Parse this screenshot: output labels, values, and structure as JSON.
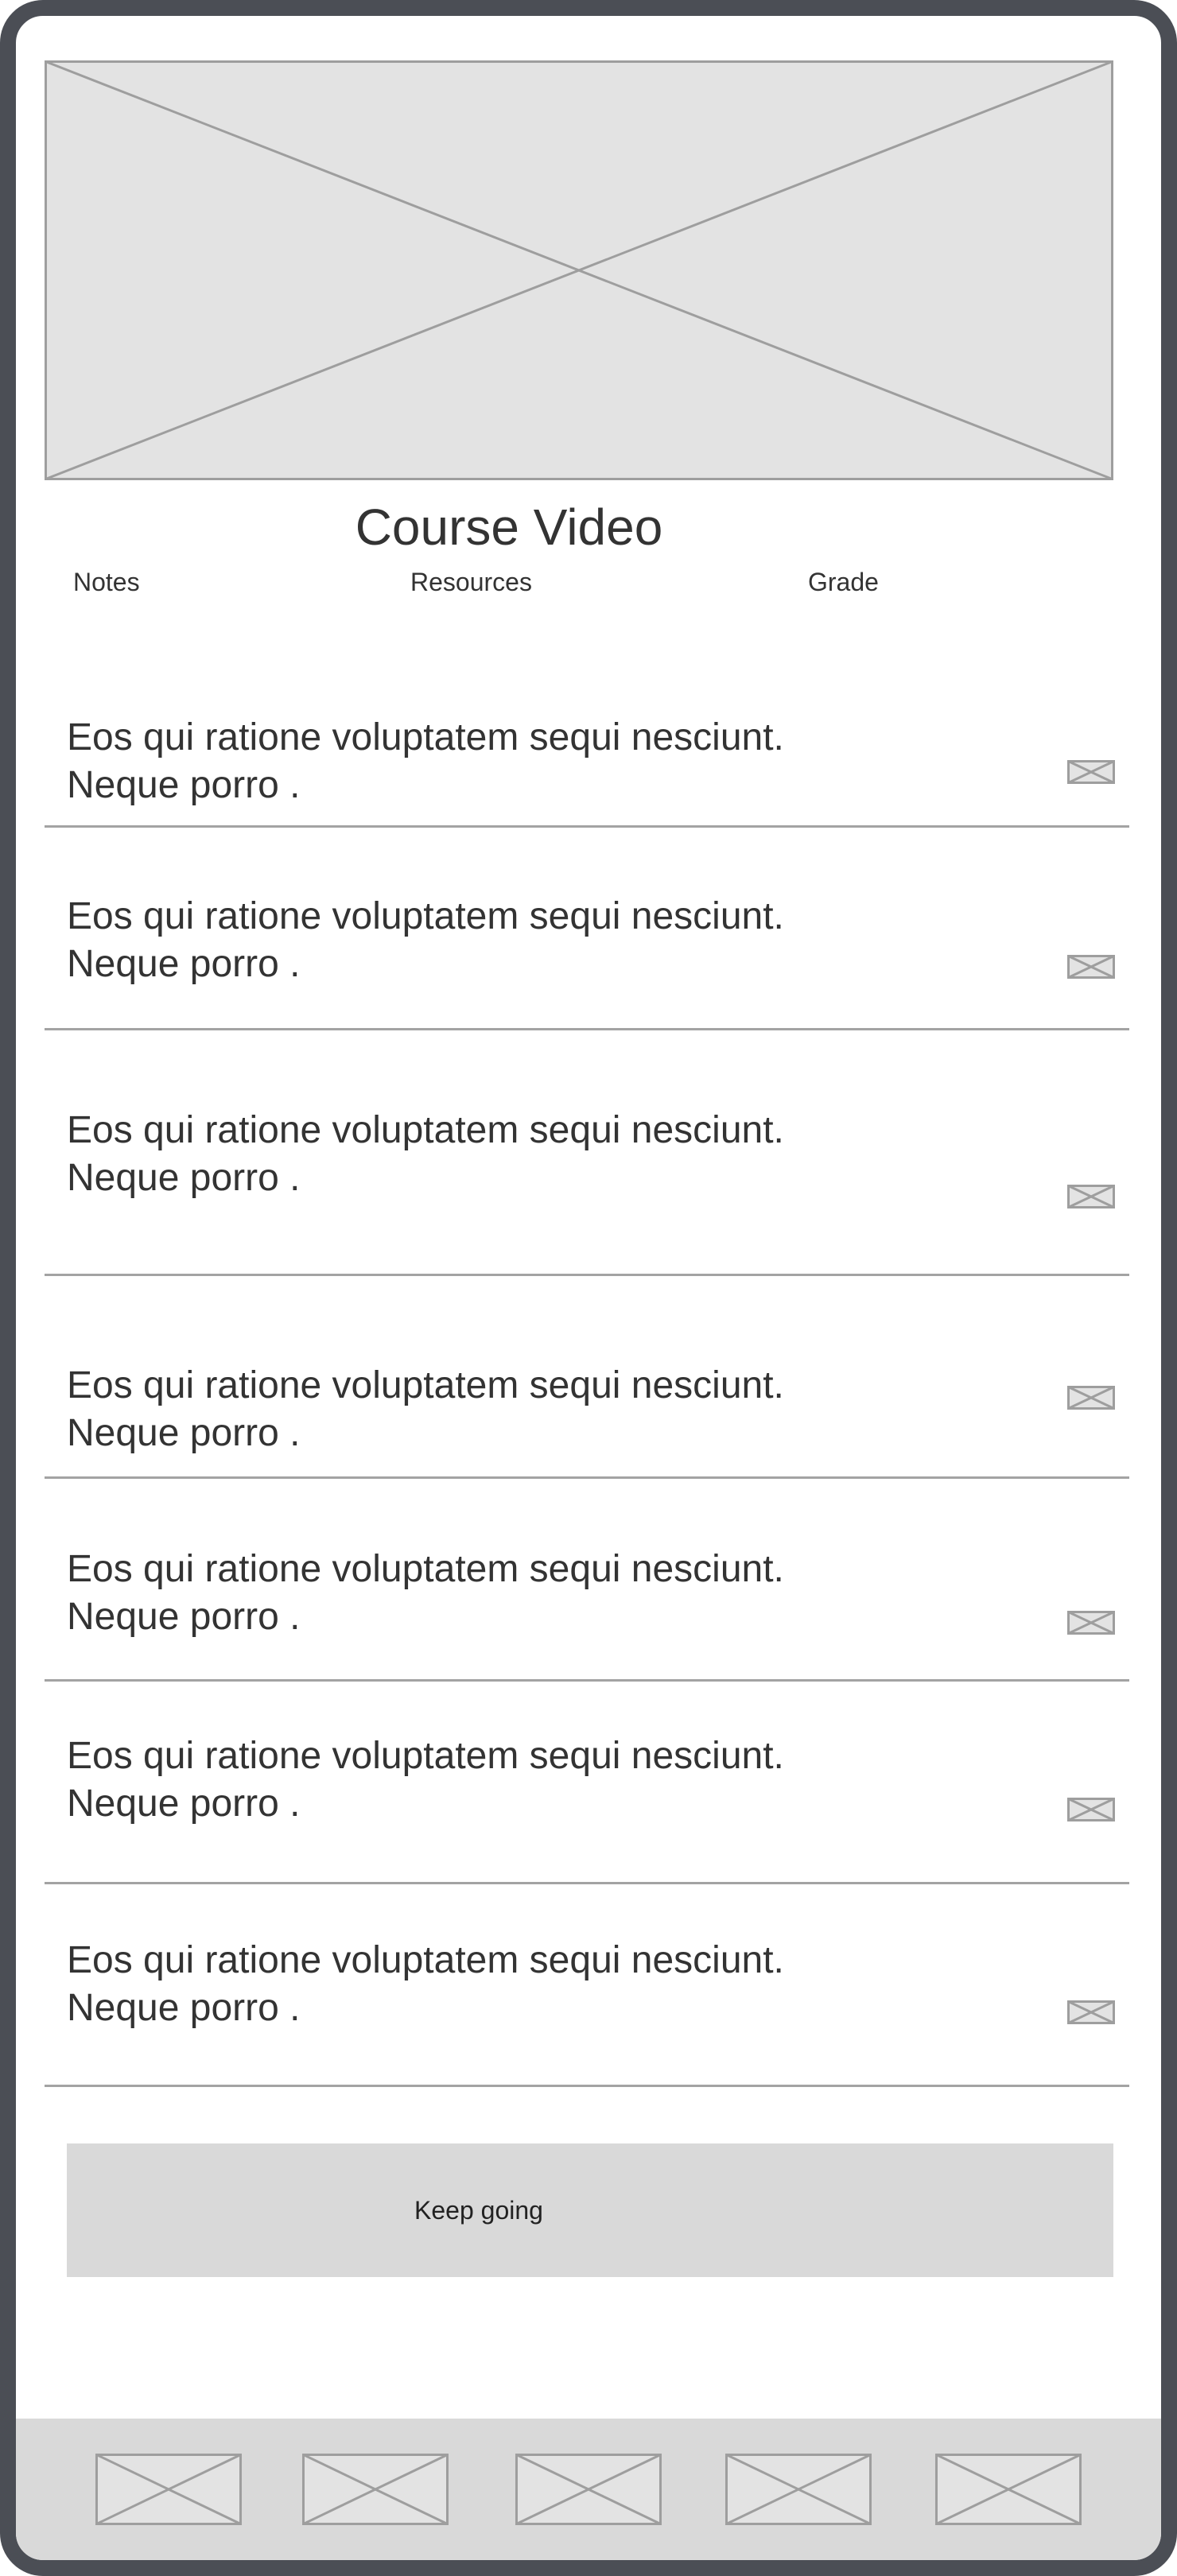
{
  "video": {
    "title": "Course Video",
    "placeholder_icon": "video-placeholder-icon"
  },
  "tabs": [
    {
      "label": "Notes"
    },
    {
      "label": "Resources"
    },
    {
      "label": "Grade"
    }
  ],
  "lessons": [
    {
      "line1": "Eos qui ratione voluptatem sequi nesciunt.",
      "line2": "Neque porro .",
      "icon": "image-placeholder-icon"
    },
    {
      "line1": "Eos qui ratione voluptatem sequi nesciunt.",
      "line2": "Neque porro .",
      "icon": "image-placeholder-icon"
    },
    {
      "line1": "Eos qui ratione voluptatem sequi nesciunt.",
      "line2": "Neque porro .",
      "icon": "image-placeholder-icon"
    },
    {
      "line1": "Eos qui ratione voluptatem sequi nesciunt.",
      "line2": "Neque porro .",
      "icon": "image-placeholder-icon"
    },
    {
      "line1": "Eos qui ratione voluptatem sequi nesciunt.",
      "line2": "Neque porro .",
      "icon": "image-placeholder-icon"
    },
    {
      "line1": "Eos qui ratione voluptatem sequi nesciunt.",
      "line2": "Neque porro .",
      "icon": "image-placeholder-icon"
    },
    {
      "line1": "Eos qui ratione voluptatem sequi nesciunt.",
      "line2": "Neque porro .",
      "icon": "image-placeholder-icon"
    }
  ],
  "cta": {
    "label": "Keep going"
  },
  "bottom_nav": [
    {
      "icon": "nav-placeholder-icon"
    },
    {
      "icon": "nav-placeholder-icon"
    },
    {
      "icon": "nav-placeholder-icon"
    },
    {
      "icon": "nav-placeholder-icon"
    },
    {
      "icon": "nav-placeholder-icon"
    }
  ],
  "colors": {
    "frame": "#4b4e55",
    "placeholder_fill": "#e3e3e3",
    "placeholder_stroke": "#9e9e9e",
    "divider": "#a3a3a3",
    "button_fill": "#d9d9d9",
    "bottom_bar": "#d9d9d9"
  }
}
